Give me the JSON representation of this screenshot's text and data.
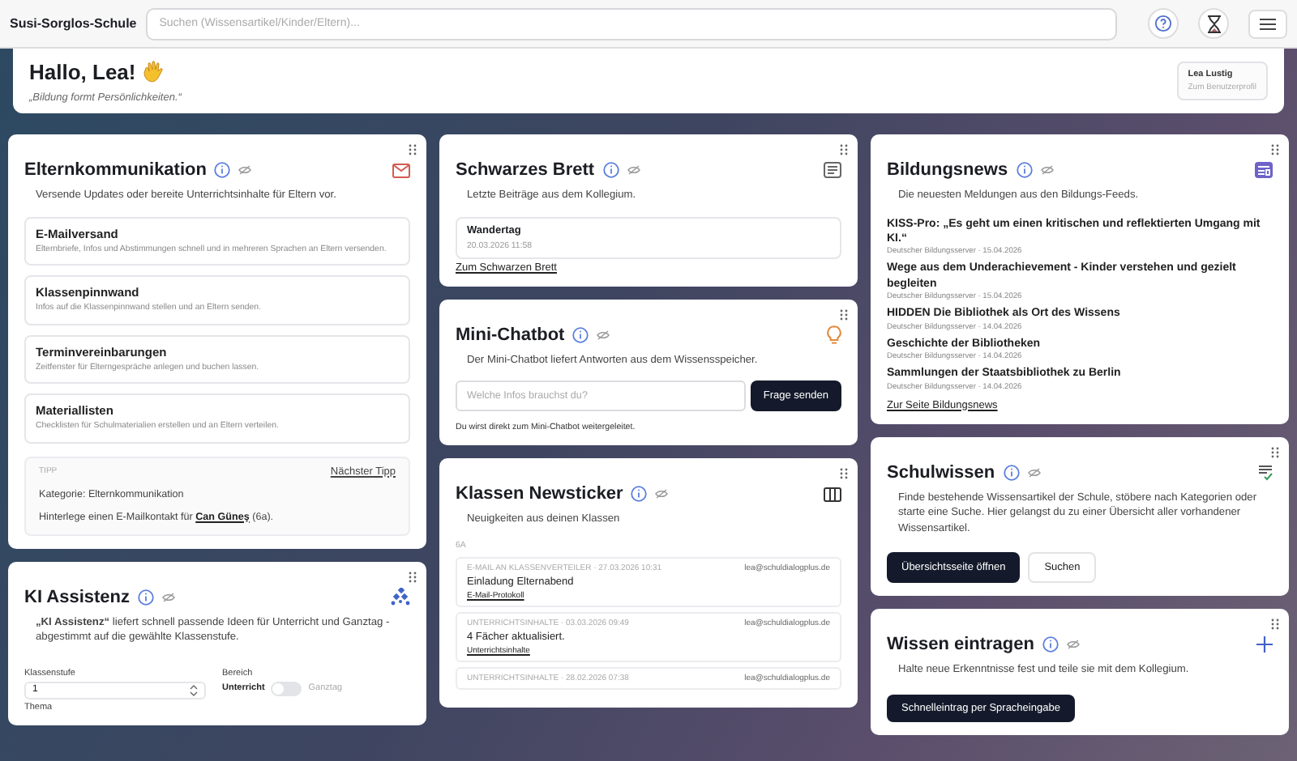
{
  "header": {
    "brand": "Susi-Sorglos-Schule",
    "search": {
      "placeholder": "Suchen (Wissensartikel/Kinder/Eltern)..."
    }
  },
  "greeting": {
    "title": "Hallo, Lea!",
    "quote": "„Bildung formt Persönlichkeiten.“",
    "user": {
      "name": "Lea Lustig",
      "link": "Zum Benutzerprofil"
    }
  },
  "columns": [
    [
      {
        "kind": "parents",
        "title": "Elternkommunikation",
        "description": "Versende Updates oder bereite Unterrichtsinhalte für Eltern vor.",
        "items": [
          {
            "title": "E-Mailversand",
            "text": "Elternbriefe, Infos und Abstimmungen schnell und in mehreren Sprachen an Eltern versenden."
          },
          {
            "title": "Klassenpinnwand",
            "text": "Infos auf die Klassenpinnwand stellen und an Eltern senden."
          },
          {
            "title": "Terminvereinbarungen",
            "text": "Zeitfenster für Elterngespräche anlegen und buchen lassen."
          },
          {
            "title": "Materiallisten",
            "text": "Checklisten für Schulmaterialien erstellen und an Eltern verteilen."
          }
        ],
        "tip": {
          "label": "TIPP",
          "next": "Nächster Tipp",
          "category": "Kategorie: Elternkommunikation",
          "before": "Hinterlege einen E-Mailkontakt für",
          "link": "Can Güneş",
          "after": "(6a)."
        }
      },
      {
        "kind": "assistant",
        "title": "KI Assistenz",
        "description": "**„KI Assistenz“** liefert schnell passende Ideen für Unterricht und Ganztag - abgestimmt auf die gewählte Klassenstufe.",
        "grade": {
          "label": "Klassenstufe",
          "value": "1"
        },
        "area": {
          "label": "Bereich",
          "left": "Unterricht",
          "right": "Ganztag",
          "on": false
        },
        "topic_label": "Thema"
      }
    ],
    [
      {
        "kind": "board",
        "title": "Schwarzes Brett",
        "description": "Letzte Beiträge aus dem Kollegium.",
        "posts": [
          {
            "title": "Wandertag",
            "date": "20.03.2026 11:58"
          }
        ],
        "link": "Zum Schwarzen Brett"
      },
      {
        "kind": "chatbot",
        "title": "Mini-Chatbot",
        "description": "Der Mini-Chatbot liefert Antworten aus dem Wissensspeicher.",
        "input": {
          "placeholder": "Welche Infos brauchst du?"
        },
        "button": "Frage senden",
        "note": "Du wirst direkt zum Mini-Chatbot weitergeleitet."
      },
      {
        "kind": "newsticker",
        "title": "Klassen Newsticker",
        "description": "Neuigkeiten aus deinen Klassen",
        "group": "6A",
        "entries": [
          {
            "meta": "E-MAIL AN KLASSENVERTEILER · 27.03.2026 10:31",
            "sender": "lea@schuldialogplus.de",
            "title": "Einladung Elternabend",
            "link": "E-Mail-Protokoll"
          },
          {
            "meta": "UNTERRICHTSINHALTE · 03.03.2026 09:49",
            "sender": "lea@schuldialogplus.de",
            "title": "4 Fächer aktualisiert.",
            "link": "Unterrichtsinhalte"
          },
          {
            "meta": "UNTERRICHTSINHALTE · 28.02.2026 07:38",
            "sender": "lea@schuldialogplus.de"
          }
        ]
      }
    ],
    [
      {
        "kind": "feed",
        "title": "Bildungsnews",
        "description": "Die neuesten Meldungen aus den Bildungs-Feeds.",
        "news": [
          {
            "title": "KISS-Pro: „Es geht um einen kritischen und reflektierten Umgang mit KI.“",
            "source": "Deutscher Bildungsserver · 15.04.2026"
          },
          {
            "title": "Wege aus dem Underachievement - Kinder verstehen und gezielt begleiten",
            "source": "Deutscher Bildungsserver · 15.04.2026"
          },
          {
            "title": "HIDDEN Die Bibliothek als Ort des Wissens",
            "source": "Deutscher Bildungsserver · 14.04.2026"
          },
          {
            "title": "Geschichte der Bibliotheken",
            "source": "Deutscher Bildungsserver · 14.04.2026"
          },
          {
            "title": "Sammlungen der Staatsbibliothek zu Berlin",
            "source": "Deutscher Bildungsserver · 14.04.2026"
          }
        ],
        "link": "Zur Seite Bildungsnews"
      },
      {
        "kind": "knowledge",
        "title": "Schulwissen",
        "description": "Finde bestehende Wissensartikel der Schule, stöbere nach Kategorien oder starte eine Suche. Hier gelangst du zu einer Übersicht aller vorhandener Wissensartikel.",
        "buttons": [
          {
            "label": "Übersichtsseite öffnen",
            "kind": "primary"
          },
          {
            "label": "Suchen",
            "kind": "secondary"
          }
        ]
      },
      {
        "kind": "entry",
        "title": "Wissen eintragen",
        "description": "Halte neue Erkenntnisse fest und teile sie mit dem Kollegium.",
        "button": "Schnelleintrag per Spracheingabe"
      }
    ]
  ]
}
